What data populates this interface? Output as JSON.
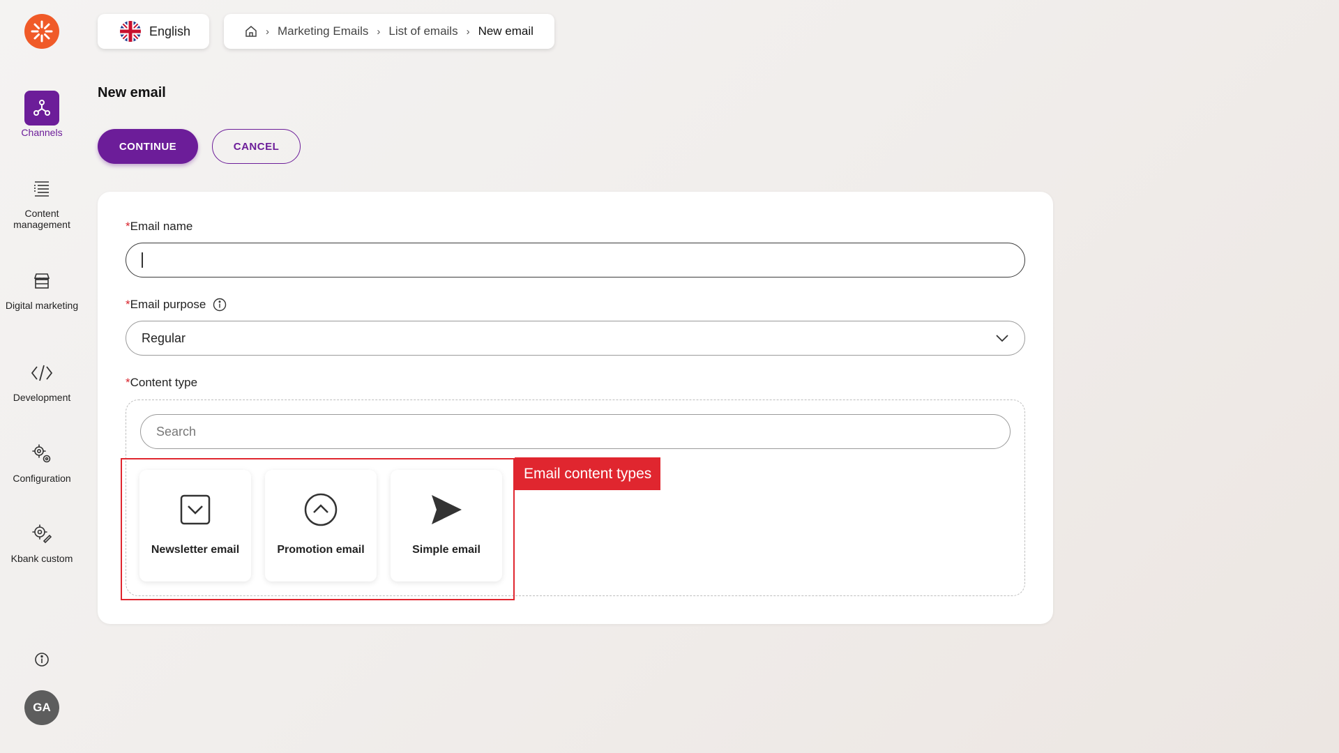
{
  "sidebar": {
    "items": [
      {
        "label": "Channels",
        "icon": "channels-icon",
        "active": true
      },
      {
        "label": "Content management",
        "icon": "content-management-icon"
      },
      {
        "label": "Digital marketing",
        "icon": "digital-marketing-icon"
      },
      {
        "label": "Development",
        "icon": "code-icon"
      },
      {
        "label": "Configuration",
        "icon": "gears-icon"
      },
      {
        "label": "Kbank custom",
        "icon": "custom-gear-icon"
      }
    ],
    "avatar_initials": "GA"
  },
  "header": {
    "language": "English",
    "breadcrumb": [
      "Marketing Emails",
      "List of emails",
      "New email"
    ]
  },
  "page": {
    "title": "New email",
    "continue_label": "CONTINUE",
    "cancel_label": "CANCEL"
  },
  "form": {
    "email_name": {
      "required_mark": "*",
      "label": "Email name",
      "value": ""
    },
    "email_purpose": {
      "required_mark": "*",
      "label": "Email purpose",
      "value": "Regular"
    },
    "content_type": {
      "required_mark": "*",
      "label": "Content type",
      "search_placeholder": "Search",
      "tiles": [
        {
          "label": "Newsletter email",
          "icon": "checkbox-chevron-icon"
        },
        {
          "label": "Promotion email",
          "icon": "circle-chevron-up-icon"
        },
        {
          "label": "Simple email",
          "icon": "send-icon"
        }
      ]
    }
  },
  "annotation": {
    "label": "Email content types",
    "color": "#e0262f"
  },
  "colors": {
    "accent": "#6c1d99",
    "logo": "#f05a28"
  }
}
